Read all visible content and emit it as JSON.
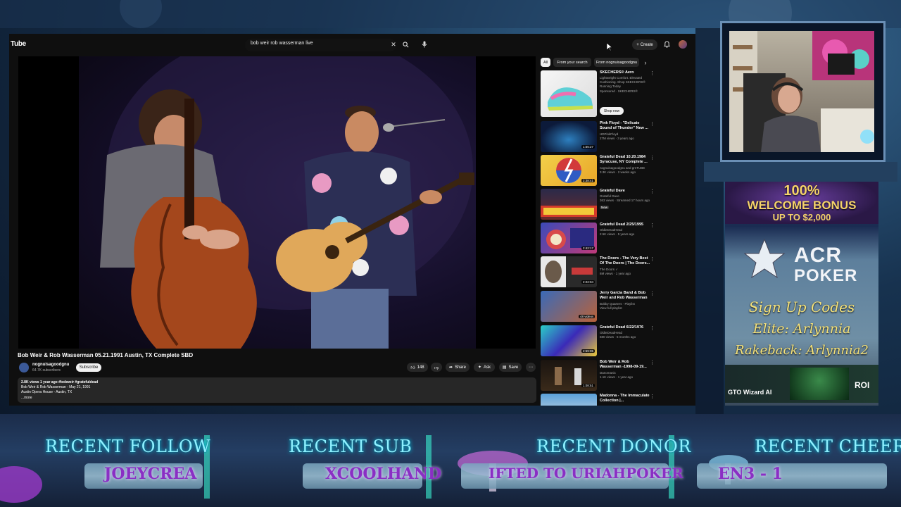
{
  "youtube": {
    "logo": "Tube",
    "search": {
      "query": "bob weir rob wasserman live"
    },
    "create_label": "Create",
    "video": {
      "title": "Bob Weir & Rob Wasserman 05.21.1991 Austin, TX Complete SBD",
      "channel": "nognuisagoodgnu",
      "subscribers": "64.7K subscribers",
      "subscribe_label": "Subscribe",
      "likes": "148",
      "share_label": "Share",
      "ask_label": "Ask",
      "save_label": "Save",
      "description": {
        "stats": "2.8K views  1 year ago  #bobweir #gratefuldead",
        "line1": "Bob Weir & Rob Wasserman - May 21, 1991",
        "line2": "Austin Opera House - Austin, TX",
        "more": "...more"
      }
    },
    "chips": [
      "All",
      "From your search",
      "From nognuisagoodgnu"
    ],
    "ad": {
      "title": "SKECHERS® Aero",
      "lines": [
        "Lightweight Comfort. Elevated",
        "Cushioning. Shop SKECHERS®",
        "Running Today"
      ],
      "sponsor": "Sponsored · SKECHERS®",
      "cta": "Shop now"
    },
    "recommendations": [
      {
        "title": "Pink Floyd - \"Delicate Sound of Thunder\" New ...",
        "channel": "HDPinkFloyd",
        "meta": "27M views · 3 years ago",
        "duration": "1:55:27"
      },
      {
        "title": "Grateful Dead 10.20.1984 Syracuse, NY Complete ...",
        "channel": "nognuisagoodgnu and grnTUBE",
        "meta": "3.3K views · 2 weeks ago",
        "duration": "2:38:41"
      },
      {
        "title": "Grateful Dave",
        "channel": "Grateful Dave",
        "meta": "363 views · Streamed 17 hours ago",
        "duration": "New"
      },
      {
        "title": "Grateful Dead 2/25/1995",
        "channel": "OldieDeadHead",
        "meta": "2.5K views · 5 years ago",
        "duration": "2:42:17"
      },
      {
        "title": "The Doors - The Very Best Of The Doors | The Doors...",
        "channel": "The Doors ✓",
        "meta": "8M views · 1 year ago",
        "duration": "2:22:04"
      },
      {
        "title": "Jerry Garcia Band & Bob Weir and Rob Wasserman",
        "channel": "Bobby Quarters · Playlist",
        "meta": "View full playlist",
        "duration": "48 videos"
      },
      {
        "title": "Grateful Dead 6/22/1976",
        "channel": "OldieDeadHead",
        "meta": "680 views · 5 months ago",
        "duration": "2:59:05"
      },
      {
        "title": "Bob Weir & Rob Wasserman -1998-09-19...",
        "channel": "Danomanix",
        "meta": "1.1K views · 1 year ago",
        "duration": "1:08:51"
      },
      {
        "title": "Madonna - The Immaculate Collection |...",
        "channel": "",
        "meta": "",
        "duration": ""
      }
    ]
  },
  "overlay": {
    "ad_panel": {
      "bonus_title": "100%",
      "bonus_sub": "WELCOME BONUS",
      "bonus_amount": "UP TO $2,000",
      "brand_top": "ACR",
      "brand_bottom": "POKER",
      "signup": "Sign Up Codes",
      "elite": "Elite: Arlynnia",
      "rakeback": "Rakeback: Arlynnia2",
      "gto": "GTO Wizard AI",
      "roi": "ROI"
    },
    "labels": {
      "follow_label": "RECENT FOLLOW",
      "follow_value": "JOEYCREA",
      "sub_label": "RECENT SUB",
      "sub_value": "XCOOLHAND",
      "donor_label": "RECENT DONOR",
      "donor_value": "IFTED TO URIAHPOKER",
      "cheer_label": "RECENT CHEER",
      "cheer_value": "EN3 - 1"
    }
  }
}
